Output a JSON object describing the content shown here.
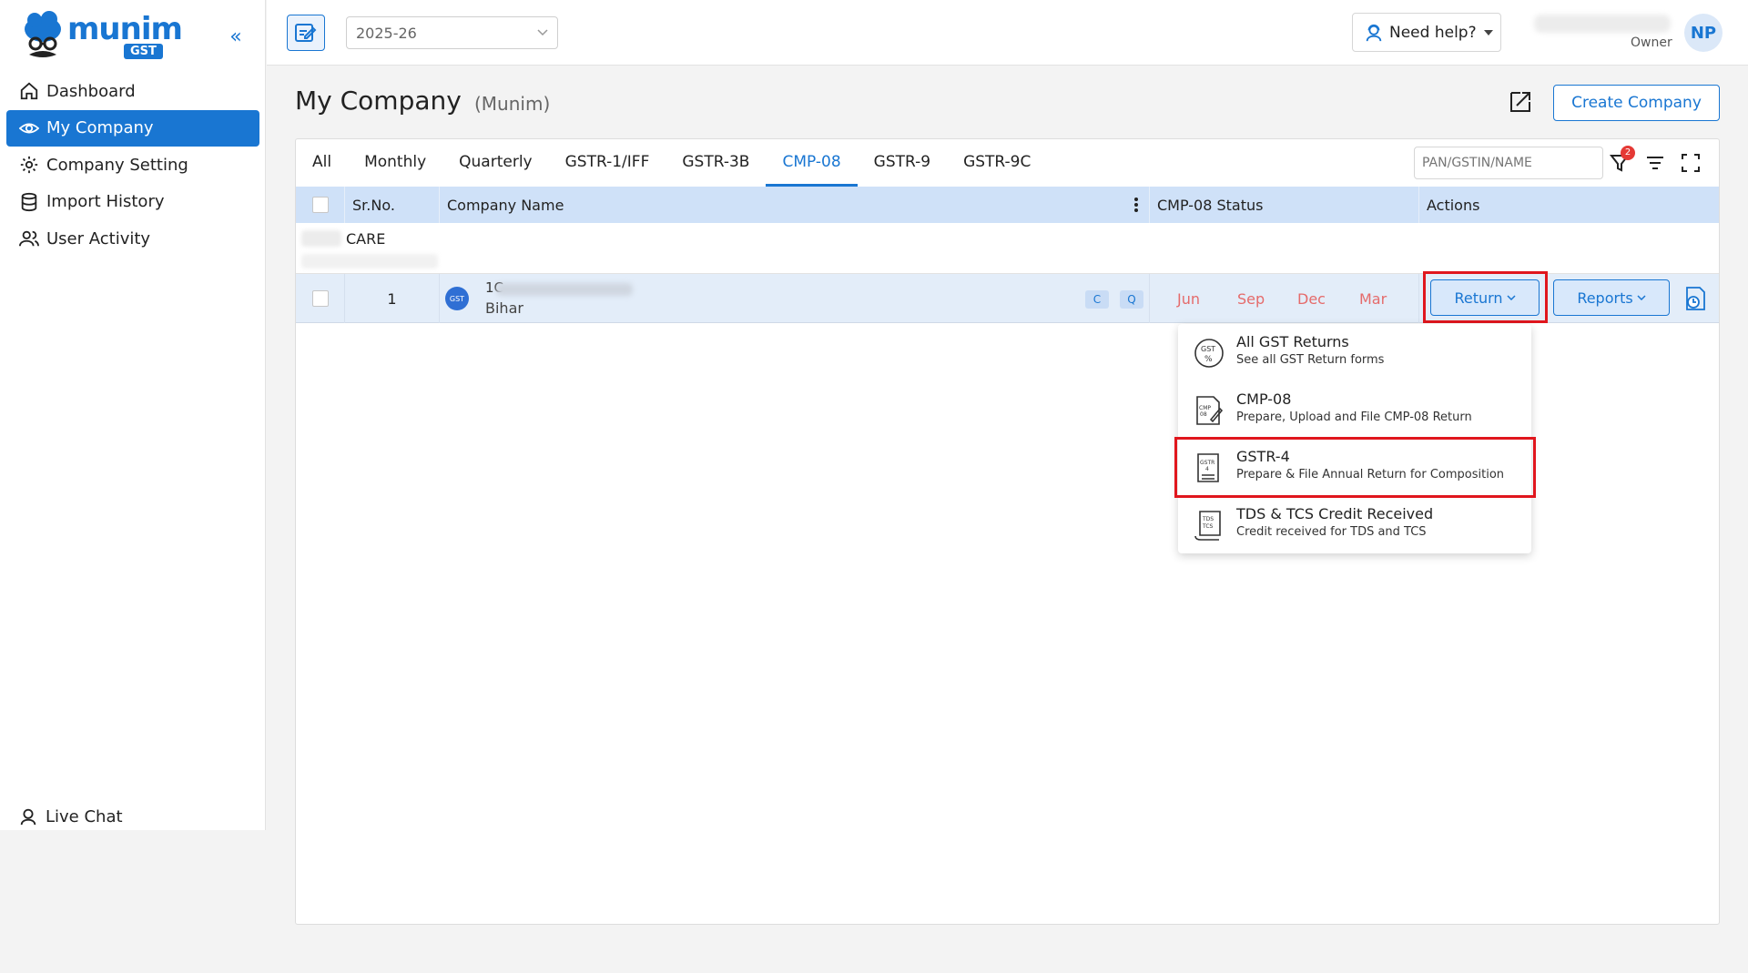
{
  "brand": {
    "name": "munim",
    "badge": "GST"
  },
  "sidebar": {
    "collapse_label": "«",
    "items": [
      {
        "label": "Dashboard",
        "icon": "home-icon",
        "active": false
      },
      {
        "label": "My Company",
        "icon": "eye-icon",
        "active": true
      },
      {
        "label": "Company Setting",
        "icon": "gear-icon",
        "active": false
      },
      {
        "label": "Import History",
        "icon": "database-icon",
        "active": false
      },
      {
        "label": "User Activity",
        "icon": "users-icon",
        "active": false
      }
    ],
    "live_chat": "Live Chat"
  },
  "topbar": {
    "year": "2025-26",
    "help_label": "Need help?",
    "role": "Owner",
    "avatar_initials": "NP"
  },
  "page": {
    "title": "My Company",
    "subtitle": "(Munim)",
    "create_button": "Create Company"
  },
  "tabs": [
    {
      "label": "All",
      "active": false
    },
    {
      "label": "Monthly",
      "active": false
    },
    {
      "label": "Quarterly",
      "active": false
    },
    {
      "label": "GSTR-1/IFF",
      "active": false
    },
    {
      "label": "GSTR-3B",
      "active": false
    },
    {
      "label": "CMP-08",
      "active": true
    },
    {
      "label": "GSTR-9",
      "active": false
    },
    {
      "label": "GSTR-9C",
      "active": false
    }
  ],
  "search": {
    "placeholder": "PAN/GSTIN/NAME"
  },
  "filter_badge_count": "2",
  "table": {
    "headers": {
      "srno": "Sr.No.",
      "company": "Company Name",
      "status": "CMP-08 Status",
      "actions": "Actions"
    },
    "group_name": "CARE",
    "rows": [
      {
        "srno": "1",
        "gstin_prefix": "1C",
        "state": "Bihar",
        "chips": [
          "C",
          "Q"
        ],
        "months": [
          "Jun",
          "Sep",
          "Dec",
          "Mar"
        ],
        "return_label": "Return",
        "reports_label": "Reports"
      }
    ]
  },
  "return_menu": [
    {
      "title": "All GST Returns",
      "subtitle": "See all GST Return forms",
      "icon": "gst-percent-icon"
    },
    {
      "title": "CMP-08",
      "subtitle": "Prepare, Upload and File CMP-08 Return",
      "icon": "cmp08-doc-icon"
    },
    {
      "title": "GSTR-4",
      "subtitle": "Prepare & File Annual Return for Composition",
      "icon": "gstr4-doc-icon"
    },
    {
      "title": "TDS & TCS Credit Received",
      "subtitle": "Credit received for TDS and TCS",
      "icon": "tds-tcs-doc-icon"
    }
  ],
  "colors": {
    "accent": "#1976d2",
    "header_bg": "#cfe1f8",
    "row_bg": "#e3edf9",
    "month_text": "#e56b6b",
    "highlight": "#e0161d"
  }
}
